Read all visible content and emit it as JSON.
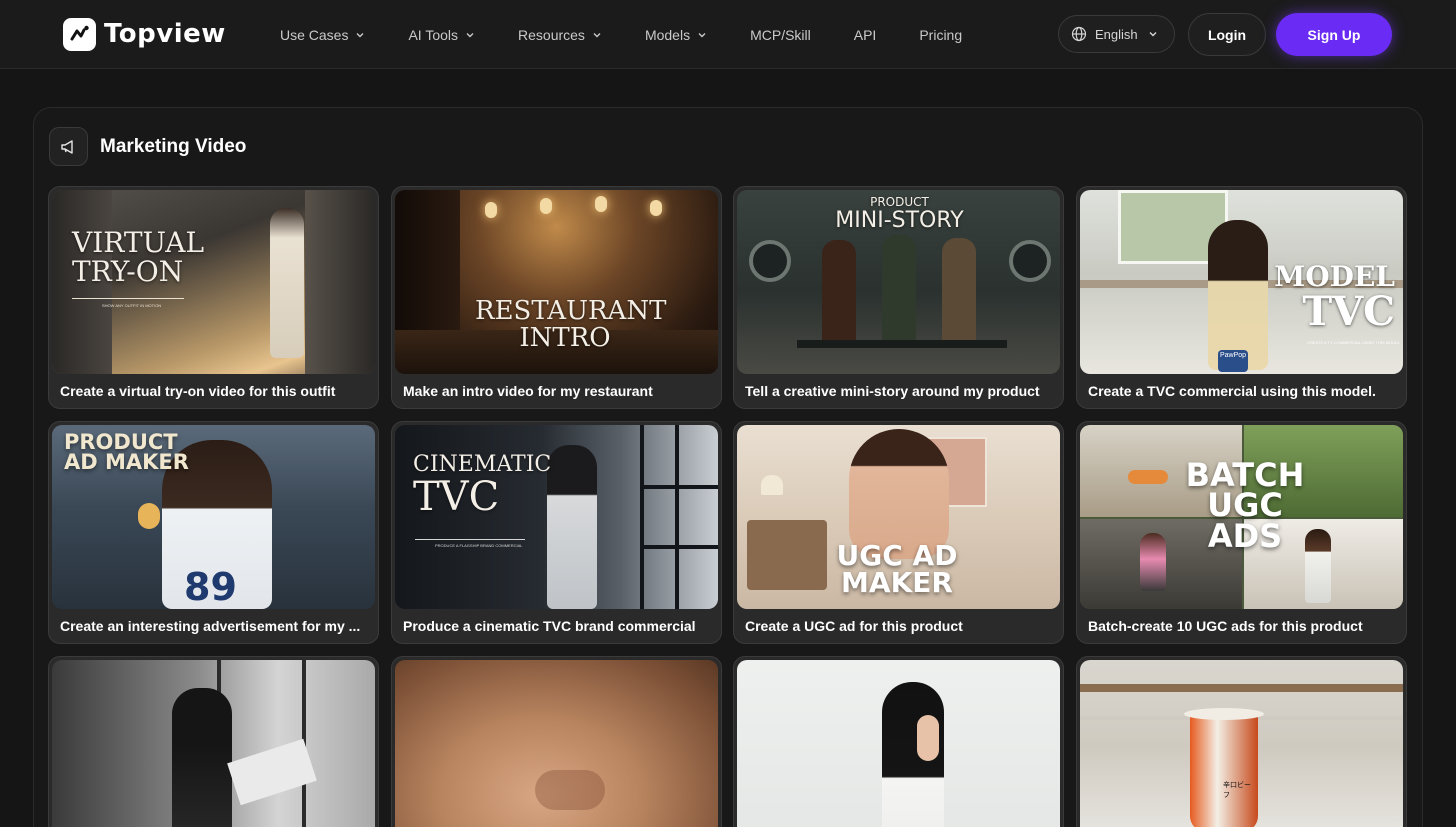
{
  "brand": {
    "name": "Topview"
  },
  "nav": {
    "items": [
      {
        "label": "Use Cases",
        "has_dropdown": true
      },
      {
        "label": "AI Tools",
        "has_dropdown": true
      },
      {
        "label": "Resources",
        "has_dropdown": true
      },
      {
        "label": "Models",
        "has_dropdown": true
      },
      {
        "label": "MCP/Skill",
        "has_dropdown": false
      },
      {
        "label": "API",
        "has_dropdown": false
      },
      {
        "label": "Pricing",
        "has_dropdown": false
      }
    ]
  },
  "header": {
    "language": "English",
    "login_label": "Login",
    "signup_label": "Sign Up"
  },
  "colors": {
    "accent": "#6a2cf5",
    "background": "#151515"
  },
  "section": {
    "icon": "megaphone-icon",
    "title": "Marketing Video"
  },
  "cards": [
    {
      "caption": "Create a virtual try-on video for this outfit",
      "overlay": [
        "VIRTUAL",
        "TRY-ON"
      ],
      "sub": "SHOW ANY OUTFIT IN MOTION"
    },
    {
      "caption": "Make an intro video for my restaurant",
      "overlay": [
        "RESTAURANT",
        "INTRO"
      ]
    },
    {
      "caption": "Tell a creative mini-story around my product",
      "overlay": [
        "PRODUCT",
        "MINI-STORY"
      ]
    },
    {
      "caption": "Create a TVC commercial using this model.",
      "overlay": [
        "MODEL",
        "TVC"
      ],
      "sub": "CREATE A TV COMMERCIAL USING THIS MODEL",
      "label": "PawPop"
    },
    {
      "caption": "Create an interesting advertisement for my ...",
      "overlay": [
        "PRODUCT",
        "AD MAKER"
      ],
      "label": "89"
    },
    {
      "caption": "Produce a cinematic TVC brand commercial",
      "overlay": [
        "CINEMATIC",
        "TVC"
      ],
      "sub": "PRODUCE A FLAGSHIP BRAND COMMERCIAL"
    },
    {
      "caption": "Create a UGC ad for this product",
      "overlay": [
        "UGC AD",
        "MAKER"
      ]
    },
    {
      "caption": "Batch-create 10 UGC ads for this product",
      "overlay": [
        "BATCH",
        "UGC",
        "ADS"
      ]
    },
    {
      "caption": ""
    },
    {
      "caption": ""
    },
    {
      "caption": ""
    },
    {
      "caption": "",
      "label": "辛口ビーフ"
    }
  ]
}
